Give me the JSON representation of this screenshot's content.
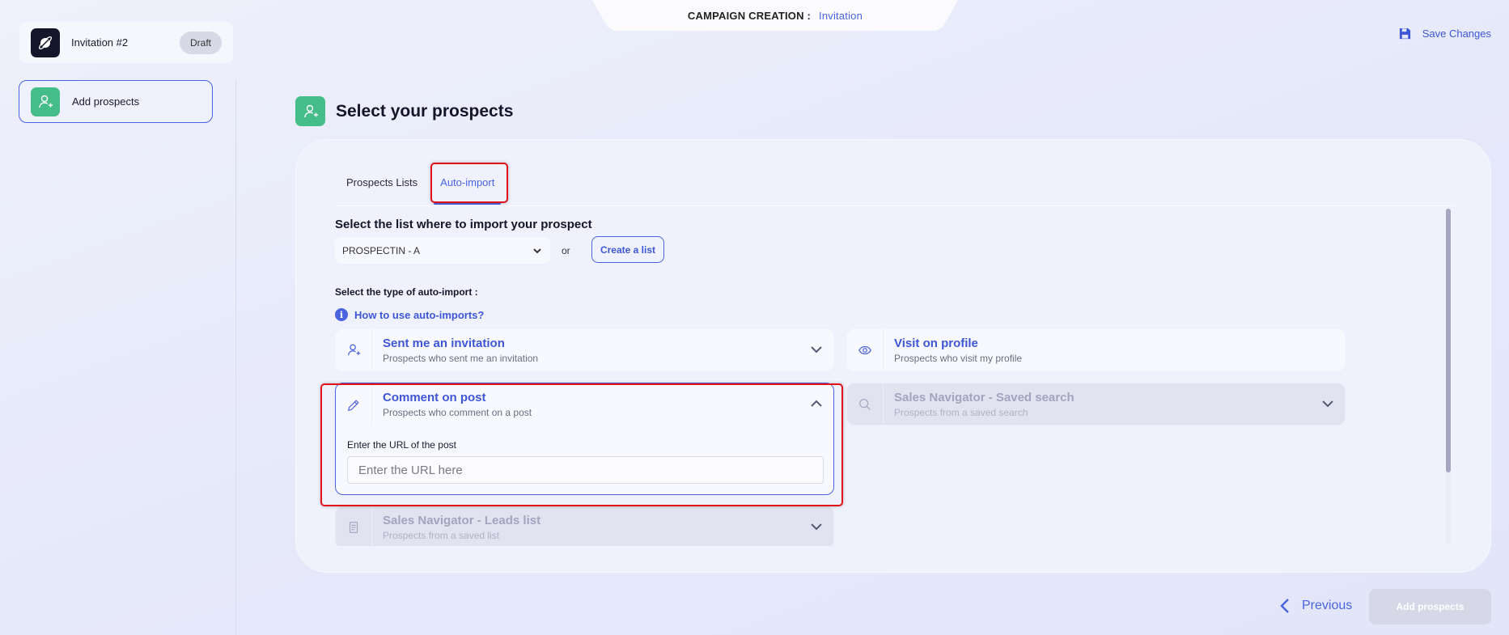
{
  "header": {
    "breadcrumb_label": "CAMPAIGN CREATION :",
    "breadcrumb_value": "Invitation",
    "save_label": "Save Changes"
  },
  "sidebar": {
    "campaign_name": "Invitation #2",
    "campaign_status": "Draft",
    "steps": [
      {
        "label": "Add prospects",
        "icon": "user-plus-icon",
        "active": true
      }
    ]
  },
  "main": {
    "title": "Select your prospects",
    "tabs": [
      {
        "label": "Prospects Lists",
        "active": false
      },
      {
        "label": "Auto-import",
        "active": true
      }
    ],
    "list_section_title": "Select the list where to import your prospect",
    "list_select_value": "PROSPECTIN - A",
    "or_text": "or",
    "create_list_label": "Create a list",
    "type_label": "Select the type of auto-import :",
    "help_link": "How to use auto-imports?",
    "options": [
      {
        "title": "Sent me an invitation",
        "subtitle": "Prospects who sent me an invitation",
        "icon": "user-plus-icon",
        "state": "collapsed"
      },
      {
        "title": "Visit on profile",
        "subtitle": "Prospects who visit my profile",
        "icon": "eye-icon",
        "state": "collapsed"
      },
      {
        "title": "Comment on post",
        "subtitle": "Prospects who comment on a post",
        "icon": "pencil-icon",
        "state": "expanded",
        "field_label": "Enter the URL of the post",
        "field_placeholder": "Enter the URL here",
        "field_value": ""
      },
      {
        "title": "Sales Navigator - Saved search",
        "subtitle": "Prospects from a saved search",
        "icon": "search-icon",
        "state": "disabled"
      },
      {
        "title": "Sales Navigator - Leads list",
        "subtitle": "Prospects from a saved list",
        "icon": "list-icon",
        "state": "disabled"
      }
    ]
  },
  "footer": {
    "previous_label": "Previous",
    "submit_label": "Add prospects"
  },
  "colors": {
    "accent": "#4a63e0",
    "success": "#45bd89",
    "highlight": "#e0121a"
  }
}
